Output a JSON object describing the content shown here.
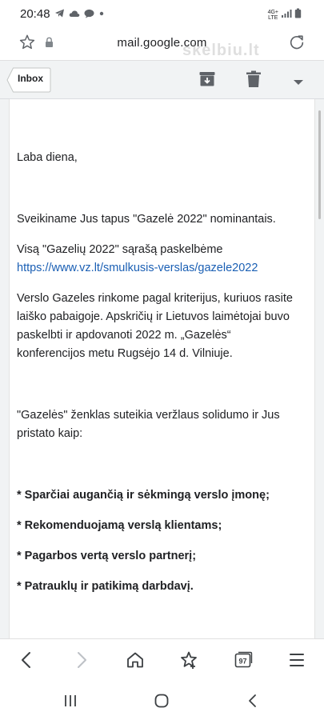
{
  "status_bar": {
    "time": "20:48",
    "network_label_top": "4G+",
    "network_label_bottom": "LTE",
    "icons": [
      "telegram-icon",
      "cloud-icon",
      "messenger-icon",
      "dot-icon",
      "signal-icon",
      "battery-icon"
    ]
  },
  "url_bar": {
    "url": "mail.google.com",
    "watermark": "skelbiu.lt"
  },
  "toolbar": {
    "inbox_label": "Inbox",
    "icons": [
      "archive-icon",
      "trash-icon",
      "dropdown-arrow-icon"
    ]
  },
  "message": {
    "greeting": "Laba diena,",
    "congrats": "Sveikiname Jus tapus \"Gazelė 2022\" nominantais.",
    "list_line": "Visą \"Gazelių 2022\" sąrašą paskelbėme",
    "link": "https://www.vz.lt/smulkusis-verslas/gazele2022",
    "criteria_line1": "Verslo Gazeles rinkome pagal kriterijus, kuriuos rasite",
    "criteria_line2": "laiško pabaigoje. Apskričių ir Lietuvos laimėtojai buvo",
    "criteria_line3": "paskelbti ir apdovanoti 2022 m. „Gazelės“",
    "criteria_line4": "konferencijos metu Rugsėjo 14 d. Vilniuje.",
    "badge_line1": "\"Gazelės\" ženklas suteikia veržlaus solidumo ir Jus",
    "badge_line2": "pristato kaip:",
    "bullets": [
      "* Sparčiai augančią ir sėkmingą verslo įmonę;",
      "* Rekomenduojamą verslą klientams;",
      "* Pagarbos vertą verslo partnerį;",
      "* Patrauklų ir patikimą darbdavį."
    ]
  },
  "browser_nav": {
    "tabs_count": "97",
    "icons": [
      "back-icon",
      "forward-icon",
      "home-icon",
      "bookmark-star-icon",
      "tabs-icon",
      "menu-icon"
    ]
  },
  "system_nav": {
    "icons": [
      "recents-icon",
      "home-circle-icon",
      "back-chevron-icon"
    ]
  }
}
